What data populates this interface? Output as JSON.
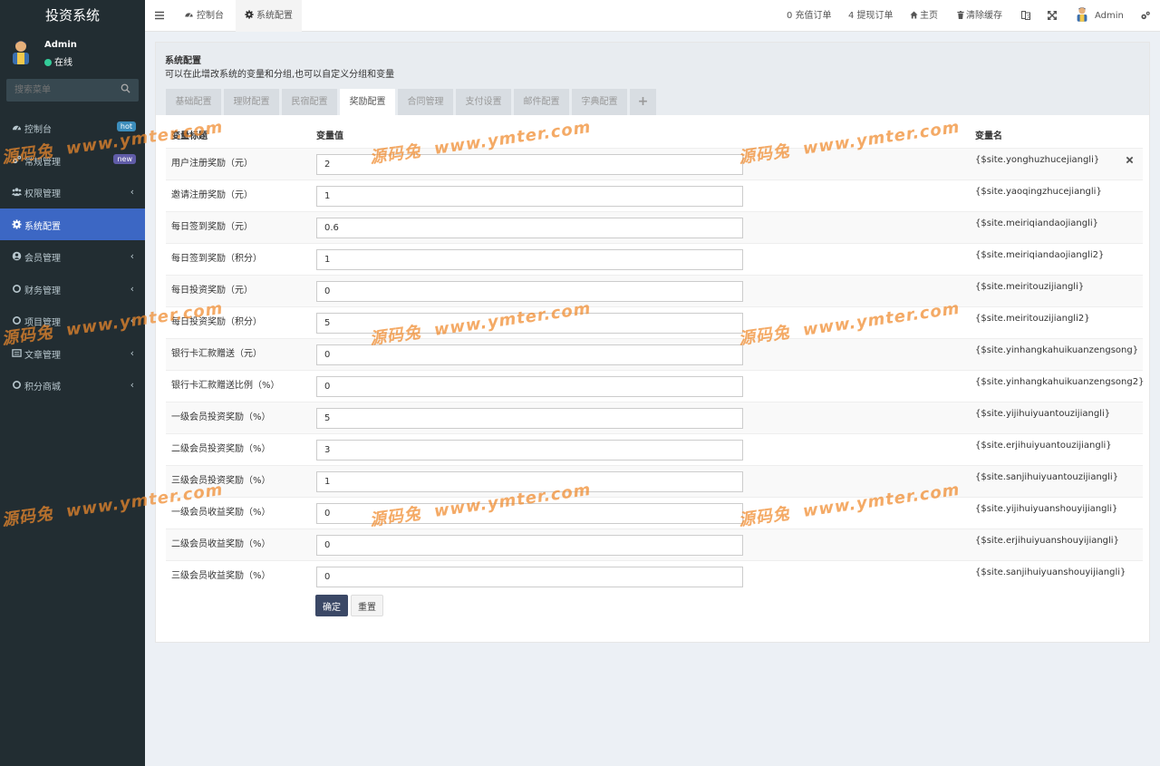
{
  "sidebar": {
    "logo": "投资系统",
    "user_name": "Admin",
    "user_status": "在线",
    "search_placeholder": "搜索菜单",
    "items": [
      {
        "label": "控制台",
        "icon": "dashboard-icon",
        "badge": "hot"
      },
      {
        "label": "常规管理",
        "icon": "cogs-icon",
        "badge": "new"
      },
      {
        "label": "权限管理",
        "icon": "group-icon",
        "arrow": "‹"
      },
      {
        "label": "系统配置",
        "icon": "gear-icon",
        "active": true
      },
      {
        "label": "会员管理",
        "icon": "user-circle-icon",
        "arrow": "‹"
      },
      {
        "label": "财务管理",
        "icon": "circle-icon",
        "arrow": "‹"
      },
      {
        "label": "项目管理",
        "icon": "circle-icon",
        "arrow": "‹"
      },
      {
        "label": "文章管理",
        "icon": "list-icon",
        "arrow": "‹"
      },
      {
        "label": "积分商城",
        "icon": "circle-icon",
        "arrow": "‹"
      }
    ]
  },
  "topbar": {
    "tabs": [
      "控制台",
      "系统配置"
    ],
    "recharge": "0 充值订单",
    "withdraw": "4 提现订单",
    "home": "主页",
    "clear_cache": "清除缓存",
    "user": "Admin"
  },
  "main": {
    "title": "系统配置",
    "description": "可以在此增改系统的变量和分组,也可以自定义分组和变量",
    "tabs": [
      "基础配置",
      "理财配置",
      "民宿配置",
      "奖励配置",
      "合同管理",
      "支付设置",
      "邮件配置",
      "字典配置",
      "+"
    ],
    "active_tab": "奖励配置",
    "columns": {
      "title": "变量标题",
      "value": "变量值",
      "name": "变量名"
    },
    "rows": [
      {
        "label": "用户注册奖励（元）",
        "value": "2",
        "var": "{$site.yonghuzhucejiangli}"
      },
      {
        "label": "邀请注册奖励（元）",
        "value": "1",
        "var": "{$site.yaoqingzhucejiangli}"
      },
      {
        "label": "每日签到奖励（元）",
        "value": "0.6",
        "var": "{$site.meiriqiandaojiangli}"
      },
      {
        "label": "每日签到奖励（积分）",
        "value": "1",
        "var": "{$site.meiriqiandaojiangli2}"
      },
      {
        "label": "每日投资奖励（元）",
        "value": "0",
        "var": "{$site.meiritouzijiangli}"
      },
      {
        "label": "每日投资奖励（积分）",
        "value": "5",
        "var": "{$site.meiritouzijiangli2}"
      },
      {
        "label": "银行卡汇款赠送（元）",
        "value": "0",
        "var": "{$site.yinhangkahuikuanzengsong}"
      },
      {
        "label": "银行卡汇款赠送比例（%）",
        "value": "0",
        "var": "{$site.yinhangkahuikuanzengsong2}"
      },
      {
        "label": "一级会员投资奖励（%）",
        "value": "5",
        "var": "{$site.yijihuiyuantouzijiangli}"
      },
      {
        "label": "二级会员投资奖励（%）",
        "value": "3",
        "var": "{$site.erjihuiyuantouzijiangli}"
      },
      {
        "label": "三级会员投资奖励（%）",
        "value": "1",
        "var": "{$site.sanjihuiyuantouzijiangli}"
      },
      {
        "label": "一级会员收益奖励（%）",
        "value": "0",
        "var": "{$site.yijihuiyuanshouyijiangli}"
      },
      {
        "label": "二级会员收益奖励（%）",
        "value": "0",
        "var": "{$site.erjihuiyuanshouyijiangli}"
      },
      {
        "label": "三级会员收益奖励（%）",
        "value": "0",
        "var": "{$site.sanjihuiyuanshouyijiangli}"
      }
    ],
    "ok_label": "确定",
    "reset_label": "重置"
  },
  "watermark": {
    "cn": "源码兔",
    "url": "www.ymter.com"
  },
  "colors": {
    "sidebar_bg": "#222d32",
    "active_menu": "#3c67c4",
    "watermark": "#f08a2c",
    "btn_primary": "#3b4866"
  }
}
